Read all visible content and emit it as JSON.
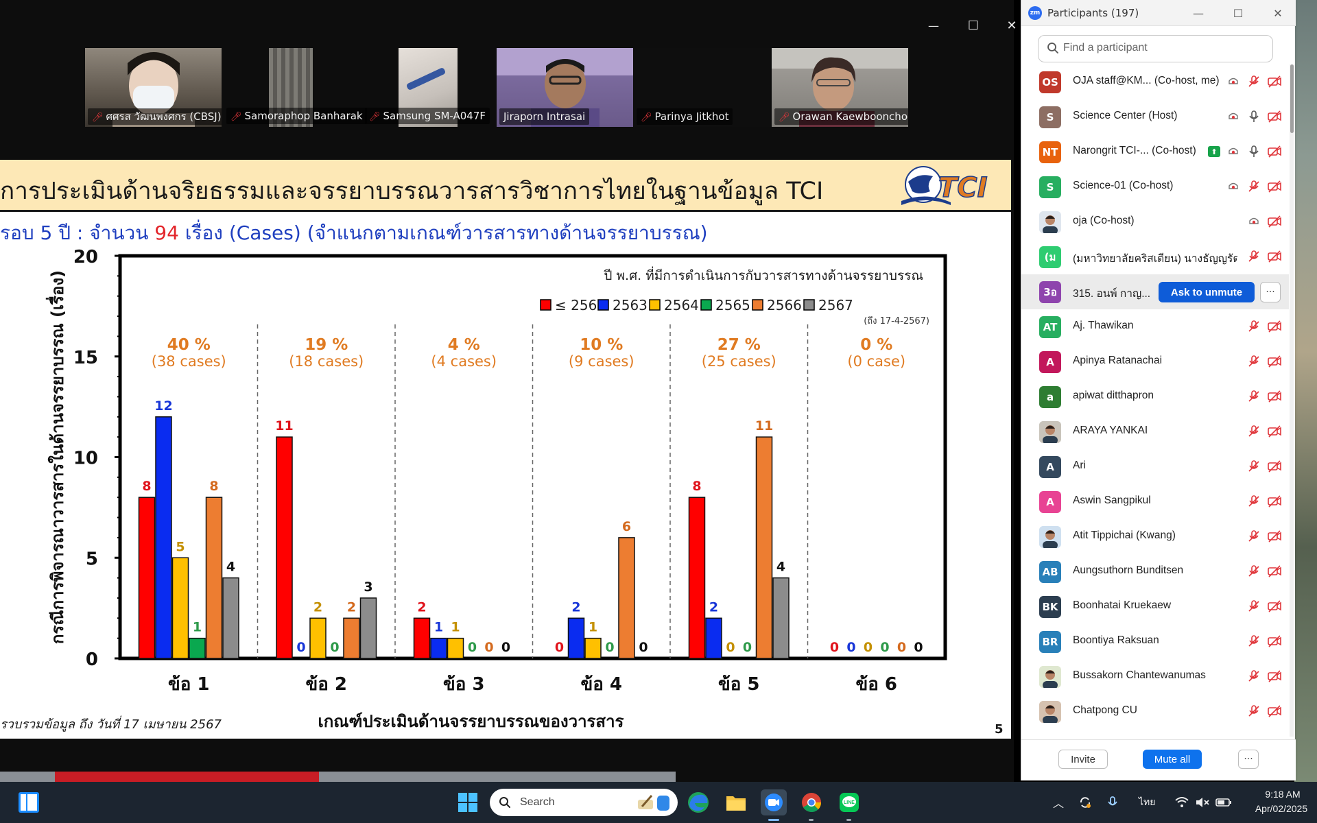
{
  "zoom_window": {
    "controls": {
      "minimize": "—",
      "maximize": "☐",
      "close": "✕"
    }
  },
  "video_tiles": [
    {
      "name": "ศศรส วัฒนพงศกร (CBSJ)",
      "muted": true,
      "bg": "#6f6a63"
    },
    {
      "name": "Samoraphop Banharak",
      "muted": true,
      "bg": "#2a2a2a"
    },
    {
      "name": "Samsung SM-A047F",
      "muted": true,
      "bg": "#2a2a2a"
    },
    {
      "name": "Jiraporn Intrasai",
      "muted": false,
      "bg": "#6a5a8a"
    },
    {
      "name": "Parinya Jitkhot",
      "muted": true,
      "bg": "#111111"
    },
    {
      "name": "Orawan Kaewboonchoo",
      "muted": true,
      "bg": "#8c8a86"
    }
  ],
  "slide": {
    "title": "การประเมินด้านจริยธรรมและจรรยาบรรณวารสารวิชาการไทยในฐานข้อมูล TCI",
    "subtitle_pre": "รอบ 5 ปี : จำนวน ",
    "subtitle_num": "94",
    "subtitle_post": " เรื่อง (Cases) (จำแนกตามเกณฑ์วารสารทางด้านจรรยาบรรณ)",
    "logo_text": "TCI",
    "footnote": "รวบรวมข้อมูล ถึง วันที่ 17 เมษายน 2567",
    "page_number": "5"
  },
  "chart_data": {
    "type": "bar",
    "title": "",
    "legend_title": "ปี พ.ศ. ที่มีการดำเนินการกับวารสารทางด้านจรรยาบรรณ",
    "legend_note": "(ถึง 17-4-2567)",
    "legend_position": "top-right",
    "xlabel": "เกณฑ์ประเมินด้านจรรยาบรรณของวารสาร",
    "ylabel": "กรณีการพิจารณาวารสารในด้านจรรยาบรรณ (เรื่อง)",
    "ylim": [
      0,
      20
    ],
    "yticks": [
      0,
      5,
      10,
      15,
      20
    ],
    "categories": [
      "ข้อ 1",
      "ข้อ 2",
      "ข้อ 3",
      "ข้อ 4",
      "ข้อ 5",
      "ข้อ 6"
    ],
    "group_pct": [
      "40 %",
      "19 %",
      "4 %",
      "10 %",
      "27 %",
      "0 %"
    ],
    "group_cases": [
      "(38 cases)",
      "(18 cases)",
      "(4 cases)",
      "(9 cases)",
      "(25 cases)",
      "(0 case)"
    ],
    "group_label_color": "#e07b22",
    "series": [
      {
        "name": "≤ 2562",
        "color": "#ff0000",
        "label_color": "#e0141c",
        "values": [
          8,
          11,
          2,
          0,
          8,
          0
        ]
      },
      {
        "name": "2563",
        "color": "#0a2cf0",
        "label_color": "#1836d8",
        "values": [
          12,
          0,
          1,
          2,
          2,
          0
        ]
      },
      {
        "name": "2564",
        "color": "#ffc000",
        "label_color": "#c49000",
        "values": [
          5,
          2,
          1,
          1,
          0,
          0
        ]
      },
      {
        "name": "2565",
        "color": "#0aa84f",
        "label_color": "#2e9a4a",
        "values": [
          1,
          0,
          0,
          0,
          0,
          0
        ]
      },
      {
        "name": "2566",
        "color": "#ed7d31",
        "label_color": "#d46a1e",
        "values": [
          8,
          2,
          0,
          6,
          11,
          0
        ]
      },
      {
        "name": "2567",
        "color": "#8c8c8c",
        "label_color": "#111111",
        "values": [
          4,
          3,
          0,
          0,
          4,
          0
        ]
      }
    ]
  },
  "participants": {
    "title": "Participants (197)",
    "search_placeholder": "Find a participant",
    "ask_unmute_label": "Ask to unmute",
    "more_label": "···",
    "items": [
      {
        "initials": "OS",
        "color": "#c0392b",
        "name": "OJA staff@KM... (Co-host, me)",
        "video_on": true,
        "mic": "off",
        "cam": "off"
      },
      {
        "initials": "S",
        "color": "#8d6e63",
        "name": "Science Center (Host)",
        "video_on": true,
        "mic": "on",
        "cam": "off"
      },
      {
        "initials": "NT",
        "color": "#e8620d",
        "name": "Narongrit TCI-... (Co-host)",
        "share": true,
        "video_on": true,
        "mic": "on",
        "cam": "off"
      },
      {
        "initials": "S",
        "color": "#27ae60",
        "name": "Science-01 (Co-host)",
        "video_on": true,
        "mic": "off",
        "cam": "off"
      },
      {
        "initials": "",
        "color": "#dfe6ee",
        "name": "oja (Co-host)",
        "photo": true,
        "video_on": true,
        "mic": "none",
        "cam": "off"
      },
      {
        "initials": "(ม",
        "color": "#2ecc71",
        "name": "(มหาวิทยาลัยคริสเตียน) นางธัญญรัตน์...",
        "mic": "off",
        "cam": "off"
      },
      {
        "initials": "3อ",
        "color": "#8e44ad",
        "name": "315. อนพ์ กาญ...",
        "hover": true
      },
      {
        "initials": "AT",
        "color": "#27ae60",
        "name": "Aj. Thawikan",
        "mic": "off",
        "cam": "off"
      },
      {
        "initials": "A",
        "color": "#c2185b",
        "name": "Apinya Ratanachai",
        "mic": "off",
        "cam": "off"
      },
      {
        "initials": "a",
        "color": "#2e7d32",
        "name": "apiwat ditthapron",
        "mic": "off",
        "cam": "off"
      },
      {
        "initials": "",
        "color": "#c9c4bb",
        "name": "ARAYA YANKAI",
        "photo": true,
        "mic": "off",
        "cam": "off"
      },
      {
        "initials": "A",
        "color": "#34495e",
        "name": "Ari",
        "mic": "off",
        "cam": "off"
      },
      {
        "initials": "A",
        "color": "#e84393",
        "name": "Aswin Sangpikul",
        "mic": "off",
        "cam": "off"
      },
      {
        "initials": "",
        "color": "#cfe0f0",
        "name": "Atit Tippichai (Kwang)",
        "photo": true,
        "mic": "off",
        "cam": "off"
      },
      {
        "initials": "AB",
        "color": "#2980b9",
        "name": "Aungsuthorn Bunditsen",
        "mic": "off",
        "cam": "off"
      },
      {
        "initials": "BK",
        "color": "#2c3e50",
        "name": "Boonhatai Kruekaew",
        "mic": "off",
        "cam": "off"
      },
      {
        "initials": "BR",
        "color": "#2980b9",
        "name": "Boontiya Raksuan",
        "mic": "off",
        "cam": "off"
      },
      {
        "initials": "",
        "color": "#dfe8d0",
        "name": "Bussakorn Chantewanumas",
        "photo": true,
        "mic": "off",
        "cam": "off"
      },
      {
        "initials": "",
        "color": "#d6c2b0",
        "name": "Chatpong CU",
        "photo": true,
        "mic": "off",
        "cam": "off"
      }
    ],
    "invite_label": "Invite",
    "mute_all_label": "Mute all",
    "footer_more_label": "···"
  },
  "taskbar": {
    "search_label": "Search",
    "apps": [
      "edge-icon",
      "file-explorer-icon",
      "zoom-icon",
      "chrome-icon",
      "line-icon"
    ],
    "lang": "ไทย",
    "time": "9:18 AM",
    "date": "Apr/02/2025"
  }
}
